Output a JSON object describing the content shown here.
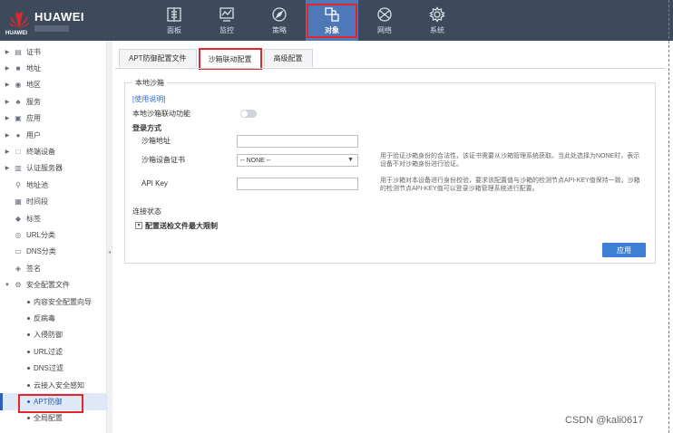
{
  "brand": {
    "name": "HUAWEI",
    "small": "HUAWEI"
  },
  "nav": [
    {
      "label": "面板",
      "icon": "dashboard-icon",
      "active": false
    },
    {
      "label": "监控",
      "icon": "monitor-icon",
      "active": false
    },
    {
      "label": "策略",
      "icon": "policy-icon",
      "active": false
    },
    {
      "label": "对象",
      "icon": "object-icon",
      "active": true
    },
    {
      "label": "网络",
      "icon": "network-icon",
      "active": false
    },
    {
      "label": "系统",
      "icon": "system-icon",
      "active": false
    }
  ],
  "sidebar": {
    "items": [
      {
        "label": "证书",
        "expandable": true,
        "icon": "certificate-icon"
      },
      {
        "label": "地址",
        "expandable": true,
        "icon": "address-icon"
      },
      {
        "label": "地区",
        "expandable": true,
        "icon": "region-icon"
      },
      {
        "label": "服务",
        "expandable": true,
        "icon": "service-icon"
      },
      {
        "label": "应用",
        "expandable": true,
        "icon": "application-icon"
      },
      {
        "label": "用户",
        "expandable": true,
        "icon": "user-icon"
      },
      {
        "label": "终端设备",
        "expandable": true,
        "icon": "terminal-icon"
      },
      {
        "label": "认证服务器",
        "expandable": true,
        "icon": "auth-server-icon"
      },
      {
        "label": "地址池",
        "expandable": false,
        "icon": "address-pool-icon"
      },
      {
        "label": "时间段",
        "expandable": false,
        "icon": "time-range-icon"
      },
      {
        "label": "标签",
        "expandable": false,
        "icon": "tag-icon"
      },
      {
        "label": "URL分类",
        "expandable": false,
        "icon": "url-category-icon"
      },
      {
        "label": "DNS分类",
        "expandable": false,
        "icon": "dns-category-icon"
      },
      {
        "label": "签名",
        "expandable": false,
        "icon": "signature-icon"
      },
      {
        "label": "安全配置文件",
        "expandable": true,
        "expanded": true,
        "icon": "security-profile-icon"
      }
    ],
    "subitems": [
      {
        "label": "内容安全配置向导"
      },
      {
        "label": "反病毒"
      },
      {
        "label": "入侵防御"
      },
      {
        "label": "URL过滤"
      },
      {
        "label": "DNS过滤"
      },
      {
        "label": "云接入安全感知"
      },
      {
        "label": "APT防御",
        "selected": true
      },
      {
        "label": "全局配置"
      }
    ]
  },
  "tabs": [
    {
      "label": "APT防御配置文件",
      "active": false
    },
    {
      "label": "沙箱联动配置",
      "active": true
    },
    {
      "label": "高级配置",
      "active": false
    }
  ],
  "panel": {
    "legend": "本地沙箱",
    "usage_link": "[使用说明]",
    "linkage_label": "本地沙箱联动功能",
    "linkage_enabled": false,
    "login_method": "登录方式",
    "sandbox_address_label": "沙箱地址",
    "sandbox_address_value": "",
    "cert_label": "沙箱设备证书",
    "cert_value": "-- NONE --",
    "cert_hint": "用于验证沙箱身份的合法性，该证书需要从沙箱管理系统获取。当此处选择为NONE时，表示设备不对沙箱身份进行验证。",
    "apikey_label": "API Key",
    "apikey_value": "",
    "apikey_hint": "用于沙箱对本设备进行身份校验，要求该配置值与沙箱的检测节点API-KEY值保持一致。沙箱的检测节点API-KEY值可以登录沙箱管理系统进行配置。",
    "conn_status": "连接状态",
    "upload_limit": "配置送检文件最大限制",
    "apply": "应用"
  },
  "watermark": "CSDN @kali0617"
}
